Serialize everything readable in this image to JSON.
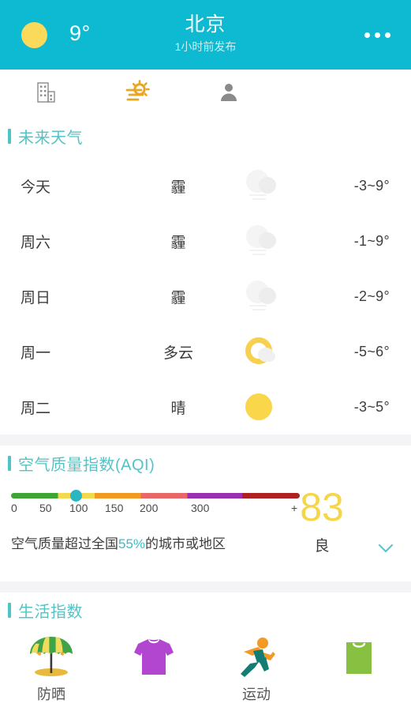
{
  "header": {
    "temperature": "9°",
    "city": "北京",
    "updated": "1小时前发布",
    "sun_icon": "sun-icon",
    "more_icon": "more-options-icon",
    "bg_color": "#0DBAD2"
  },
  "tabs": [
    {
      "name": "city-tab",
      "icon": "building-icon"
    },
    {
      "name": "weather-tab",
      "icon": "sun-haze-icon",
      "active": true
    },
    {
      "name": "profile-tab",
      "icon": "person-icon"
    }
  ],
  "forecast": {
    "section_title": "未来天气",
    "rows": [
      {
        "day": "今天",
        "condition": "霾",
        "icon": "haze-icon",
        "temp": "-3~9°"
      },
      {
        "day": "周六",
        "condition": "霾",
        "icon": "haze-icon",
        "temp": "-1~9°"
      },
      {
        "day": "周日",
        "condition": "霾",
        "icon": "haze-icon",
        "temp": "-2~9°"
      },
      {
        "day": "周一",
        "condition": "多云",
        "icon": "partly-cloudy-icon",
        "temp": "-5~6°"
      },
      {
        "day": "周二",
        "condition": "晴",
        "icon": "sunny-icon",
        "temp": "-3~5°"
      }
    ]
  },
  "aqi": {
    "section_title": "空气质量指数(AQI)",
    "value": "83",
    "level": "良",
    "value_color": "#F5D54A",
    "marker_color": "#2BB6C4",
    "marker_position_percent": 22.5,
    "scale_labels": [
      "0",
      "50",
      "100",
      "150",
      "200",
      "300",
      "+"
    ],
    "description_prefix": "空气质量超过全国",
    "description_highlight": "55%",
    "description_suffix": "的城市或地区",
    "expand_icon": "chevron-down-icon"
  },
  "life": {
    "section_title": "生活指数",
    "items": [
      {
        "icon": "beach-umbrella-icon",
        "label": "防晒",
        "label2": ""
      },
      {
        "icon": "tshirt-icon",
        "label": "",
        "label2": ""
      },
      {
        "icon": "running-icon",
        "label": "运动",
        "label2": ""
      },
      {
        "icon": "shopping-bag-icon",
        "label": "",
        "label2": ""
      }
    ]
  },
  "chart_data": {
    "type": "bar",
    "title": "空气质量指数(AQI)",
    "categories": [
      "0",
      "50",
      "100",
      "150",
      "200",
      "300",
      "+"
    ],
    "values": [
      83
    ],
    "xlabel": "AQI",
    "ylabel": "",
    "ylim": [
      0,
      500
    ]
  }
}
